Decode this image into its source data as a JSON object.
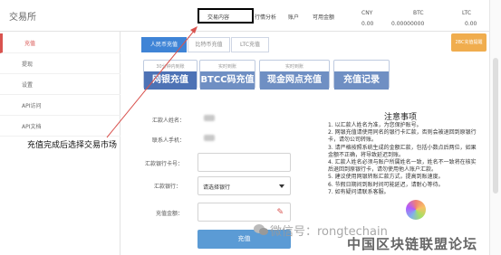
{
  "header": {
    "logo": "交易所",
    "nav": [
      {
        "label": "交易内容"
      },
      {
        "label": "行情分析"
      },
      {
        "label": "账户"
      },
      {
        "label": "可用金额"
      }
    ],
    "balances": [
      {
        "currency": "CNY",
        "value": "0.00"
      },
      {
        "currency": "BTC",
        "value": "0.00000000"
      },
      {
        "currency": "LTC",
        "value": "0.00"
      }
    ]
  },
  "sidebar": {
    "items": [
      {
        "label": "充值"
      },
      {
        "label": "提现"
      },
      {
        "label": "设置"
      },
      {
        "label": "API访问"
      },
      {
        "label": "API文档"
      }
    ]
  },
  "currency_tabs": [
    {
      "label": "人民币充值"
    },
    {
      "label": "比特币充值"
    },
    {
      "label": "LTC充值"
    }
  ],
  "orange_button": "2BC充值提醒",
  "deposit_types": [
    {
      "small": "30分钟内到账",
      "big": "网银充值"
    },
    {
      "small": "实时到账",
      "big": "BTCC码充值"
    },
    {
      "small": "实时到账",
      "big": "现金网点充值"
    },
    {
      "small": "",
      "big": "充值记录"
    }
  ],
  "form": {
    "account_name_label": "汇款人姓名：",
    "phone_label": "联系人手机：",
    "bank_card_label": "汇款银行卡号：",
    "bank_label": "汇款银行：",
    "bank_select_value": "请选择银行",
    "amount_label": "充值金额：",
    "submit_label": "充值"
  },
  "notice": {
    "title": "注意事项",
    "lines": [
      "1. 以汇款人姓名为准，为您保护账号。",
      "2. 网银充值请使用同名的银行卡汇款，否则会被退回到原银行卡，请勿公司转账。",
      "3. 请严格按照系统生成的金额汇款，包括小数点后两位，如果金额不正确，将导致延迟到账。",
      "4. 汇款人姓名必须与账户所属姓名一致，姓名不一致将在核实后退回到原银行卡，请勿使用他人账户汇款。",
      "5. 建议使用网银转账汇款方式，提高到账速度。",
      "6. 节假日期间到账时间可能延迟，请耐心等待。",
      "7. 如有疑问请联系客服。"
    ]
  },
  "annotation": "充值完成后选择交易市场",
  "watermark": {
    "line1": "微信号：rongtechain",
    "line2": "中国区块链联盟论坛"
  }
}
